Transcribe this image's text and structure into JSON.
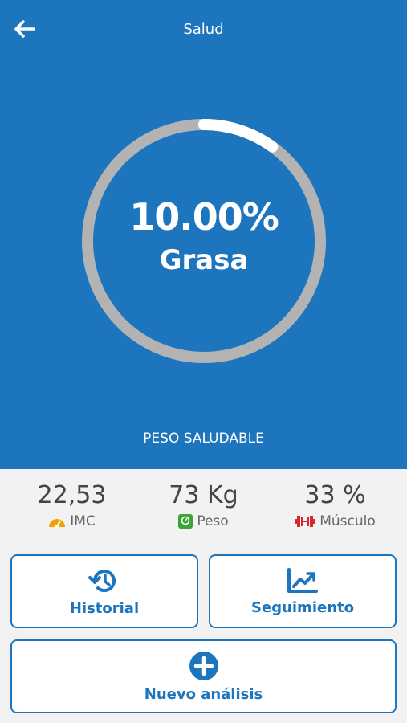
{
  "header": {
    "title": "Salud",
    "back_icon": "arrow-left-icon",
    "bg_color": "#1c75bd"
  },
  "ring": {
    "value": "10.00%",
    "label": "Grasa",
    "progress_fraction": 0.1,
    "track_color": "#b3b3b3",
    "progress_color": "#ffffff"
  },
  "status": "PESO SALUDABLE",
  "stats": [
    {
      "value": "22,53",
      "label": "IMC",
      "icon": "gauge-icon",
      "icon_color": "#f0a000"
    },
    {
      "value": "73 Kg",
      "label": "Peso",
      "icon": "scale-icon",
      "icon_color": "#3aa534"
    },
    {
      "value": "33 %",
      "label": "Músculo",
      "icon": "dumbbell-icon",
      "icon_color": "#d6282e"
    }
  ],
  "actions": {
    "historial": {
      "label": "Historial",
      "icon": "history-icon"
    },
    "seguimiento": {
      "label": "Seguimiento",
      "icon": "trend-chart-icon"
    },
    "nuevo": {
      "label": "Nuevo análisis",
      "icon": "plus-circle-icon"
    }
  },
  "accent_color": "#1c75bd"
}
